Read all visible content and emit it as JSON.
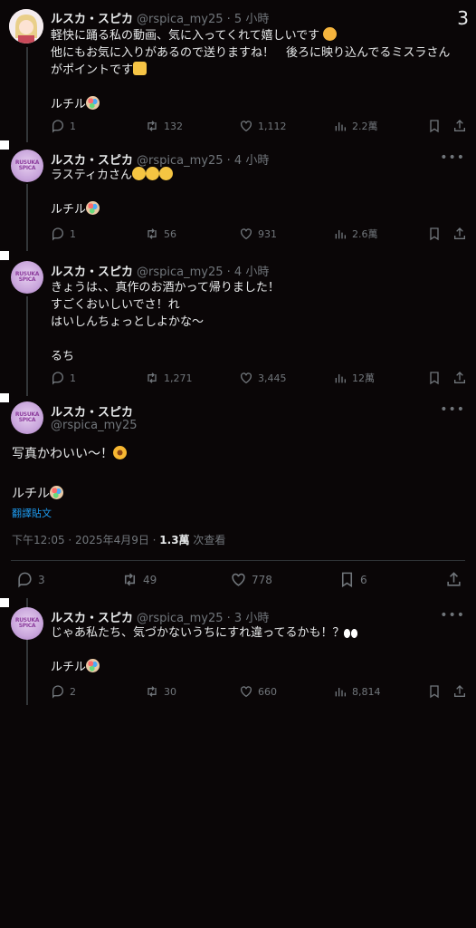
{
  "badge": "3",
  "tweets": [
    {
      "name": "ルスカ・スピカ",
      "handle": "@rspica_my25",
      "time": "· 5 小時",
      "lines": [
        "軽快に踊る私の動画、気に入ってくれて嬉しいです",
        "他にもお気に入りがあるので送りますね！　後ろに映り込んでるミスラさん",
        "がポイントです",
        "",
        "ルチル"
      ],
      "replies": "1",
      "retweets": "132",
      "likes": "1,112",
      "views": "2.2萬"
    },
    {
      "name": "ルスカ・スピカ",
      "handle": "@rspica_my25",
      "time": "· 4 小時",
      "lines": [
        "ラスティカさん",
        "",
        "ルチル"
      ],
      "replies": "1",
      "retweets": "56",
      "likes": "931",
      "views": "2.6萬"
    },
    {
      "name": "ルスカ・スピカ",
      "handle": "@rspica_my25",
      "time": "· 4 小時",
      "lines": [
        "きょうは、、真作のお酒かって帰りました！",
        "すごくおいしいでさ！れ",
        "はいしんちょっとしよかな〜",
        "",
        "るち"
      ],
      "replies": "1",
      "retweets": "1,271",
      "likes": "3,445",
      "views": "12萬"
    }
  ],
  "main_tweet": {
    "name": "ルスカ・スピカ",
    "handle": "@rspica_my25",
    "text": "写真かわいい〜！",
    "sign": "ルチル",
    "translate": "翻譯貼文",
    "meta_time": "下午12:05 · 2025年4月9日 · ",
    "meta_views": "1.3萬",
    "meta_views_label": " 次查看",
    "replies": "3",
    "retweets": "49",
    "likes": "778",
    "bookmarks": "6"
  },
  "reply_tweet": {
    "name": "ルスカ・スピカ",
    "handle": "@rspica_my25",
    "time": "· 3 小時",
    "line1": "じゃあ私たち、気づかないうちにすれ違ってるかも！？",
    "sign": "ルチル",
    "replies": "2",
    "retweets": "30",
    "likes": "660",
    "views": "8,814"
  },
  "avatar_label": "RUSUKA SPICA",
  "icons": [
    "reply-icon",
    "retweet-icon",
    "like-icon",
    "views-icon",
    "bookmark-icon",
    "share-icon",
    "more-icon"
  ]
}
